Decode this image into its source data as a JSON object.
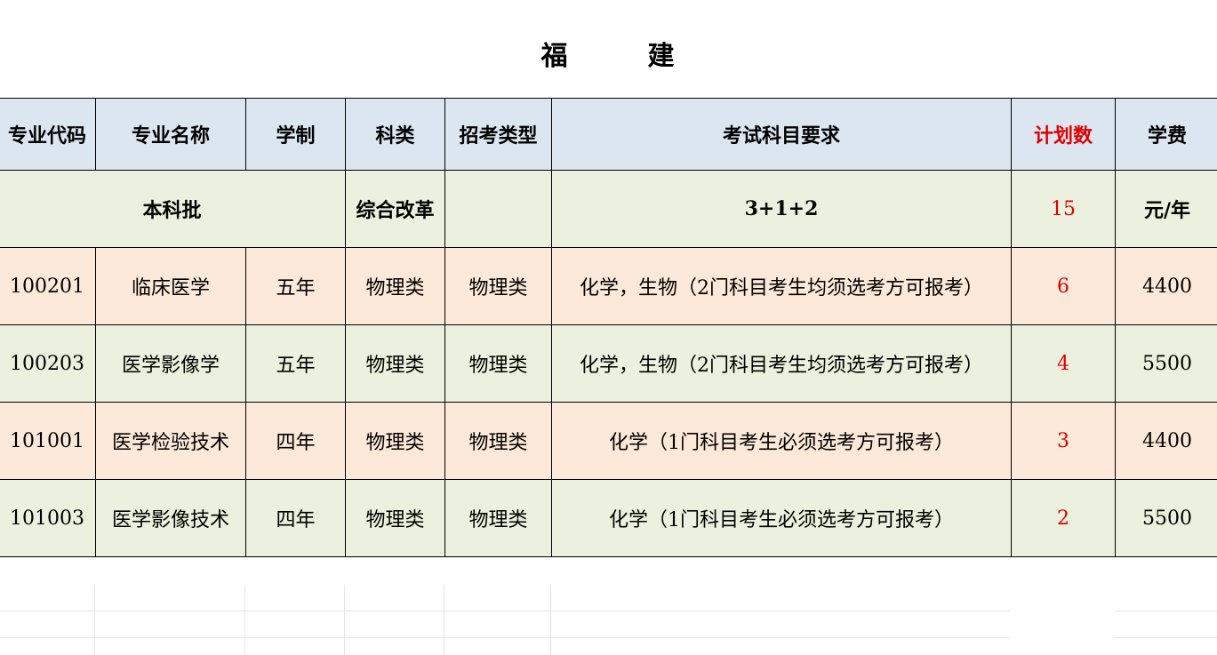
{
  "title": [
    "福",
    "建"
  ],
  "headers": {
    "code": "专业代码",
    "name": "专业名称",
    "duration": "学制",
    "category": "科类",
    "admission_type": "招考类型",
    "subjects": "考试科目要求",
    "plan": "计划数",
    "tuition": "学费"
  },
  "batch": {
    "label": "本科批",
    "category": "综合改革",
    "admission_type": "",
    "subjects": "3+1+2",
    "plan": "15",
    "tuition": "元/年"
  },
  "rows": [
    {
      "code": "100201",
      "name": "临床医学",
      "duration": "五年",
      "category": "物理类",
      "admission_type": "物理类",
      "subjects": "化学，生物（2门科目考生均须选考方可报考）",
      "plan": "6",
      "tuition": "4400"
    },
    {
      "code": "100203",
      "name": "医学影像学",
      "duration": "五年",
      "category": "物理类",
      "admission_type": "物理类",
      "subjects": "化学，生物（2门科目考生均须选考方可报考）",
      "plan": "4",
      "tuition": "5500"
    },
    {
      "code": "101001",
      "name": "医学检验技术",
      "duration": "四年",
      "category": "物理类",
      "admission_type": "物理类",
      "subjects": "化学（1门科目考生必须选考方可报考）",
      "plan": "3",
      "tuition": "4400"
    },
    {
      "code": "101003",
      "name": "医学影像技术",
      "duration": "四年",
      "category": "物理类",
      "admission_type": "物理类",
      "subjects": "化学（1门科目考生必须选考方可报考）",
      "plan": "2",
      "tuition": "5500"
    }
  ],
  "colors": {
    "header_bg": "#dce6f1",
    "green_bg": "#ebf1de",
    "peach_bg": "#fde9d9",
    "plan_text": "#e00000"
  }
}
